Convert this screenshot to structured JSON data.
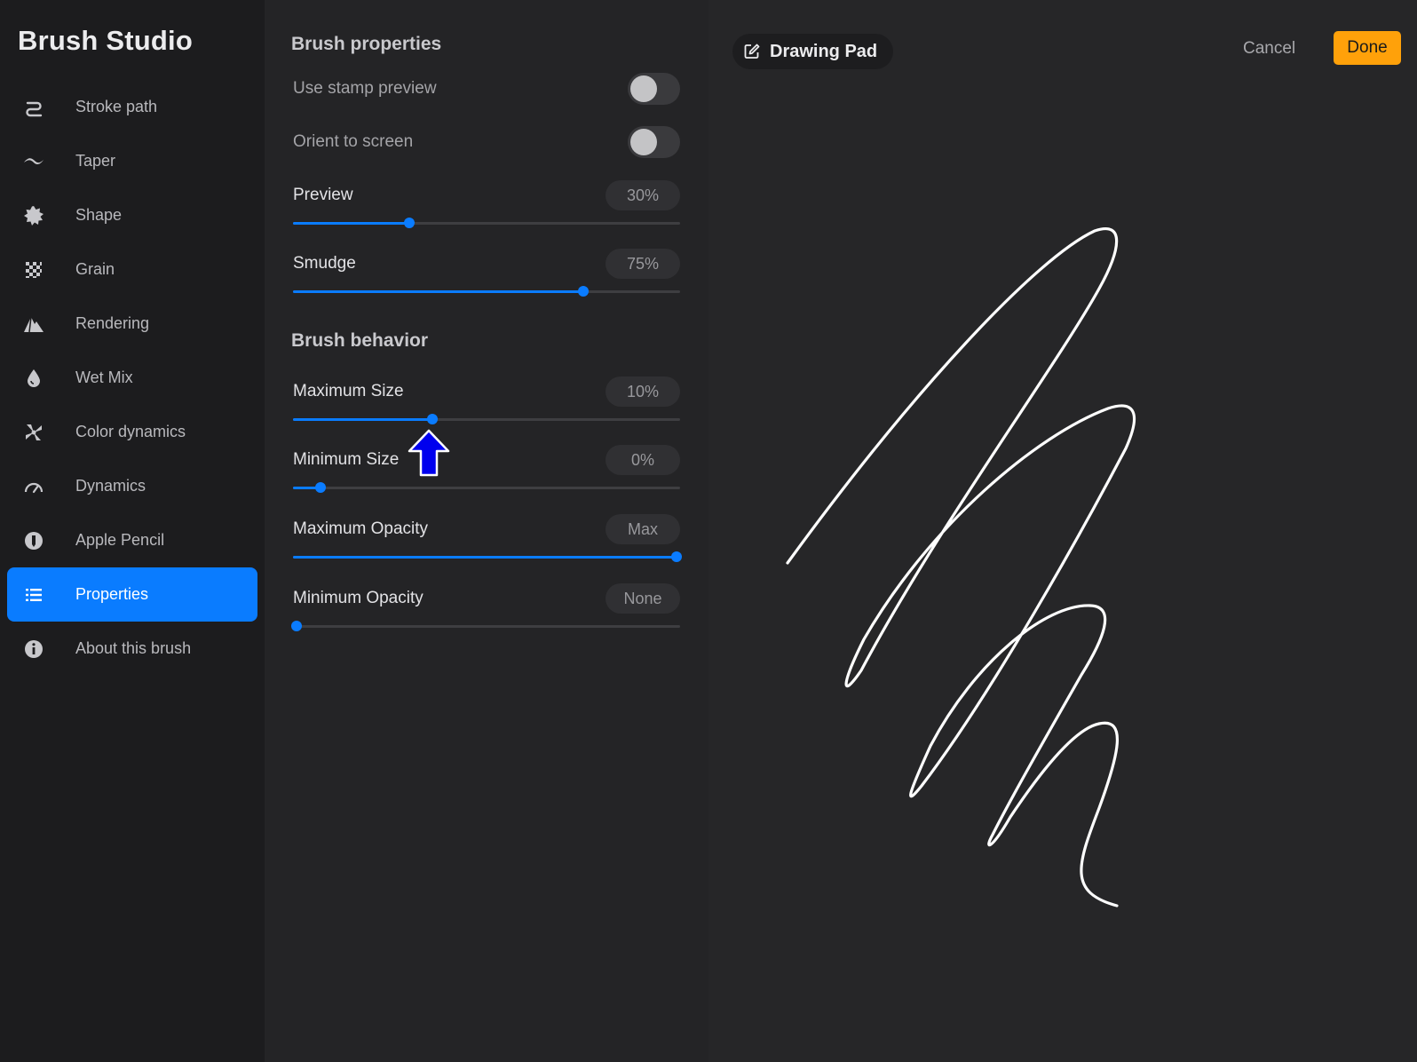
{
  "sidebar": {
    "title": "Brush Studio",
    "items": [
      {
        "label": "Stroke path",
        "icon": "stroke-path-icon"
      },
      {
        "label": "Taper",
        "icon": "taper-icon"
      },
      {
        "label": "Shape",
        "icon": "shape-icon"
      },
      {
        "label": "Grain",
        "icon": "grain-icon"
      },
      {
        "label": "Rendering",
        "icon": "rendering-icon"
      },
      {
        "label": "Wet Mix",
        "icon": "wet-mix-icon"
      },
      {
        "label": "Color dynamics",
        "icon": "color-dynamics-icon"
      },
      {
        "label": "Dynamics",
        "icon": "dynamics-icon"
      },
      {
        "label": "Apple Pencil",
        "icon": "apple-pencil-icon"
      },
      {
        "label": "Properties",
        "icon": "list-icon",
        "active": true
      },
      {
        "label": "About this brush",
        "icon": "info-icon"
      }
    ]
  },
  "properties": {
    "title": "Brush properties",
    "toggles": [
      {
        "label": "Use stamp preview",
        "on": false
      },
      {
        "label": "Orient to screen",
        "on": false
      }
    ],
    "sliders": [
      {
        "label": "Preview",
        "value": "30%",
        "level": 0.3
      },
      {
        "label": "Smudge",
        "value": "75%",
        "level": 0.75
      }
    ]
  },
  "behavior": {
    "title": "Brush behavior",
    "sliders": [
      {
        "label": "Maximum Size",
        "value": "10%",
        "level": 0.36
      },
      {
        "label": "Minimum Size",
        "value": "0%",
        "level": 0.07
      },
      {
        "label": "Maximum Opacity",
        "value": "Max",
        "level": 0.99
      },
      {
        "label": "Minimum Opacity",
        "value": "None",
        "level": 0.01
      }
    ]
  },
  "pad": {
    "title": "Drawing Pad",
    "cancel_label": "Cancel",
    "done_label": "Done"
  },
  "colors": {
    "accent": "#0a7cff",
    "done": "#ffa10a",
    "pointer": "#0000ee"
  }
}
